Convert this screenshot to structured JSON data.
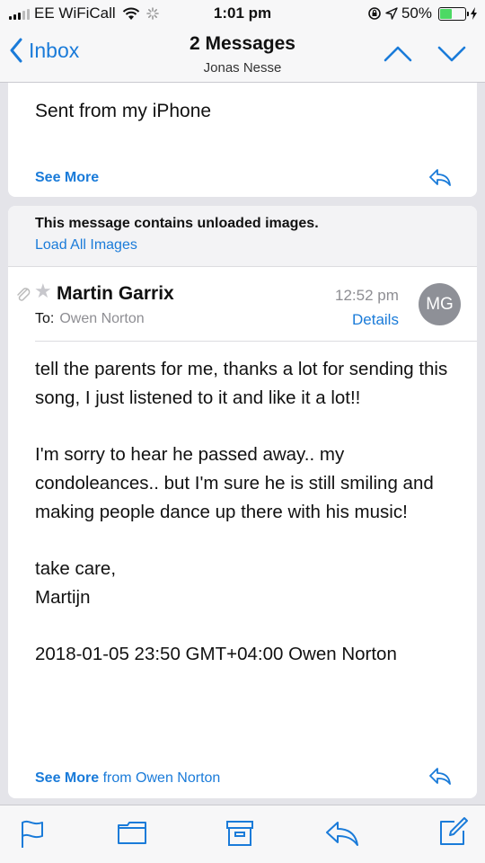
{
  "status_bar": {
    "carrier": "EE WiFiCall",
    "time": "1:01 pm",
    "battery_percent": "50%",
    "battery_level": 0.5,
    "battery_color": "#4cd964"
  },
  "nav": {
    "back_label": "Inbox",
    "title": "2 Messages",
    "subtitle": "Jonas Nesse",
    "icons": [
      "chevron-left-icon",
      "chevron-up-icon",
      "chevron-down-icon"
    ]
  },
  "previous_message": {
    "text": "Sent from my iPhone",
    "see_more": "See More",
    "icon": "reply-icon"
  },
  "current_message": {
    "banner": {
      "notice": "This message contains unloaded images.",
      "load_all": "Load All Images"
    },
    "sender": "Martin Garrix",
    "to_label": "To:",
    "to_name": "Owen Norton",
    "time": "12:52 pm",
    "details": "Details",
    "avatar_initials": "MG",
    "body": [
      "tell the parents for me, thanks a lot for sending this song, I just listened to it and like it a lot!!",
      "I'm sorry to hear he passed away.. my condoleances.. but I'm sure he is still smiling and making people dance up there with his music!",
      "take care,",
      "Martijn",
      "2018-01-05 23:50 GMT+04:00 Owen Norton"
    ],
    "see_more": "See More",
    "see_more_from": "from Owen Norton"
  },
  "toolbar": {
    "icons": [
      "flag-icon",
      "folder-icon",
      "archive-icon",
      "reply-icon",
      "compose-icon"
    ]
  },
  "colors": {
    "accent": "#1a7bd9",
    "background": "#e4e4e9",
    "avatar": "#8e9097"
  }
}
